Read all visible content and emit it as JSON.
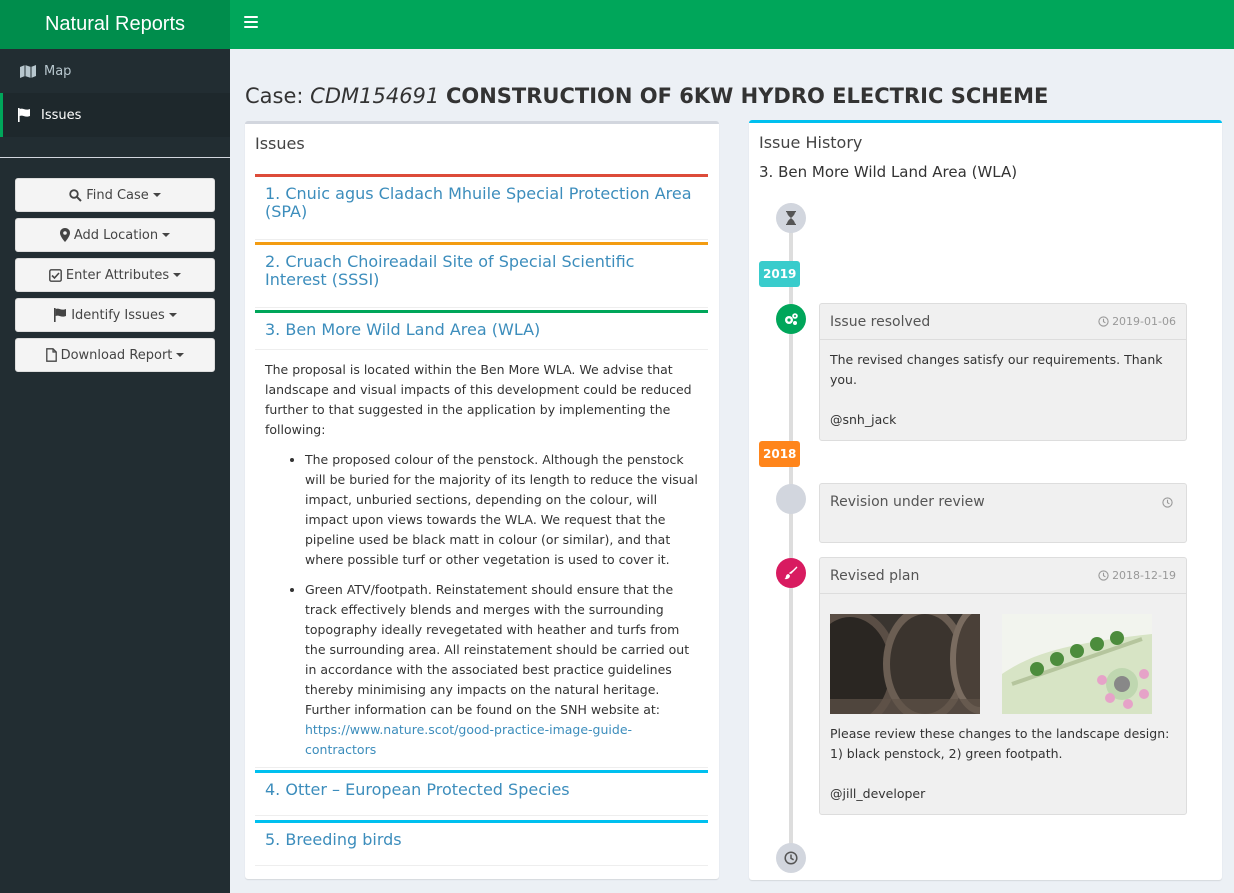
{
  "app": {
    "title": "Natural Reports"
  },
  "sidebar": {
    "items": [
      {
        "label": "Map",
        "icon": "map-icon",
        "active": false
      },
      {
        "label": "Issues",
        "icon": "flag-icon",
        "active": true
      }
    ],
    "buttons": [
      {
        "label": "Find Case",
        "icon": "search-icon"
      },
      {
        "label": "Add Location",
        "icon": "map-marker-icon"
      },
      {
        "label": "Enter Attributes",
        "icon": "checkbox-icon"
      },
      {
        "label": "Identify Issues",
        "icon": "flag-icon"
      },
      {
        "label": "Download Report",
        "icon": "file-icon"
      }
    ]
  },
  "page": {
    "case_label": "Case:",
    "case_id": "CDM154691",
    "case_name": "CONSTRUCTION OF 6KW HYDRO ELECTRIC SCHEME"
  },
  "issues": {
    "title": "Issues",
    "panels": [
      {
        "title": "1. Cnuic agus Cladach Mhuile Special Protection Area (SPA)",
        "color": "#dd4b39"
      },
      {
        "title": "2. Cruach Choireadail Site of Special Scientific Interest (SSSI)",
        "color": "#f39c12"
      },
      {
        "title": "3. Ben More Wild Land Area (WLA)",
        "color": "#00a65a"
      },
      {
        "title": "4. Otter – European Protected Species",
        "color": "#00c0ef"
      },
      {
        "title": "5. Breeding birds",
        "color": "#00c0ef"
      }
    ],
    "expanded": {
      "intro": "The proposal is located within the Ben More WLA. We advise that landscape and visual impacts of this development could be reduced further to that suggested in the application by implementing the following:",
      "bullet1": "The proposed colour of the penstock. Although the penstock will be buried for the majority of its length to reduce the visual impact, unburied sections, depending on the colour, will impact upon views towards the WLA. We request that the pipeline used be black matt in colour (or similar), and that where possible turf or other vegetation is used to cover it.",
      "bullet2_text": "Green ATV/footpath. Reinstatement should ensure that the track effectively blends and merges with the surrounding topography ideally revegetated with heather and turfs from the surrounding area. All reinstatement should be carried out in accordance with the associated best practice guidelines thereby minimising any impacts on the natural heritage. Further information can be found on the SNH website at: ",
      "bullet2_link": "https://www.nature.scot/good-practice-image-guide-contractors"
    }
  },
  "history": {
    "title": "Issue History",
    "subtitle": "3. Ben More Wild Land Area (WLA)",
    "labels": [
      {
        "text": "2019",
        "color": "#39cccc"
      },
      {
        "text": "2018",
        "color": "#ff851b"
      }
    ],
    "items": [
      {
        "title": "Issue resolved",
        "time": "2019-01-06",
        "body": "The revised changes satisfy our requirements. Thank you.",
        "by": "@snh_jack",
        "icon": "cogs-icon",
        "icon_color": "#00a65a"
      },
      {
        "title": "Revision under review",
        "time": "",
        "body": "",
        "by": "",
        "icon": "empty-circle",
        "icon_color": "#d2d6de"
      },
      {
        "title": "Revised plan",
        "time": "2018-12-19",
        "body": "Please review these changes to the landscape design: 1) black penstock, 2) green footpath.",
        "by": "@jill_developer",
        "icon": "paint-brush-icon",
        "icon_color": "#d81b60"
      }
    ]
  }
}
